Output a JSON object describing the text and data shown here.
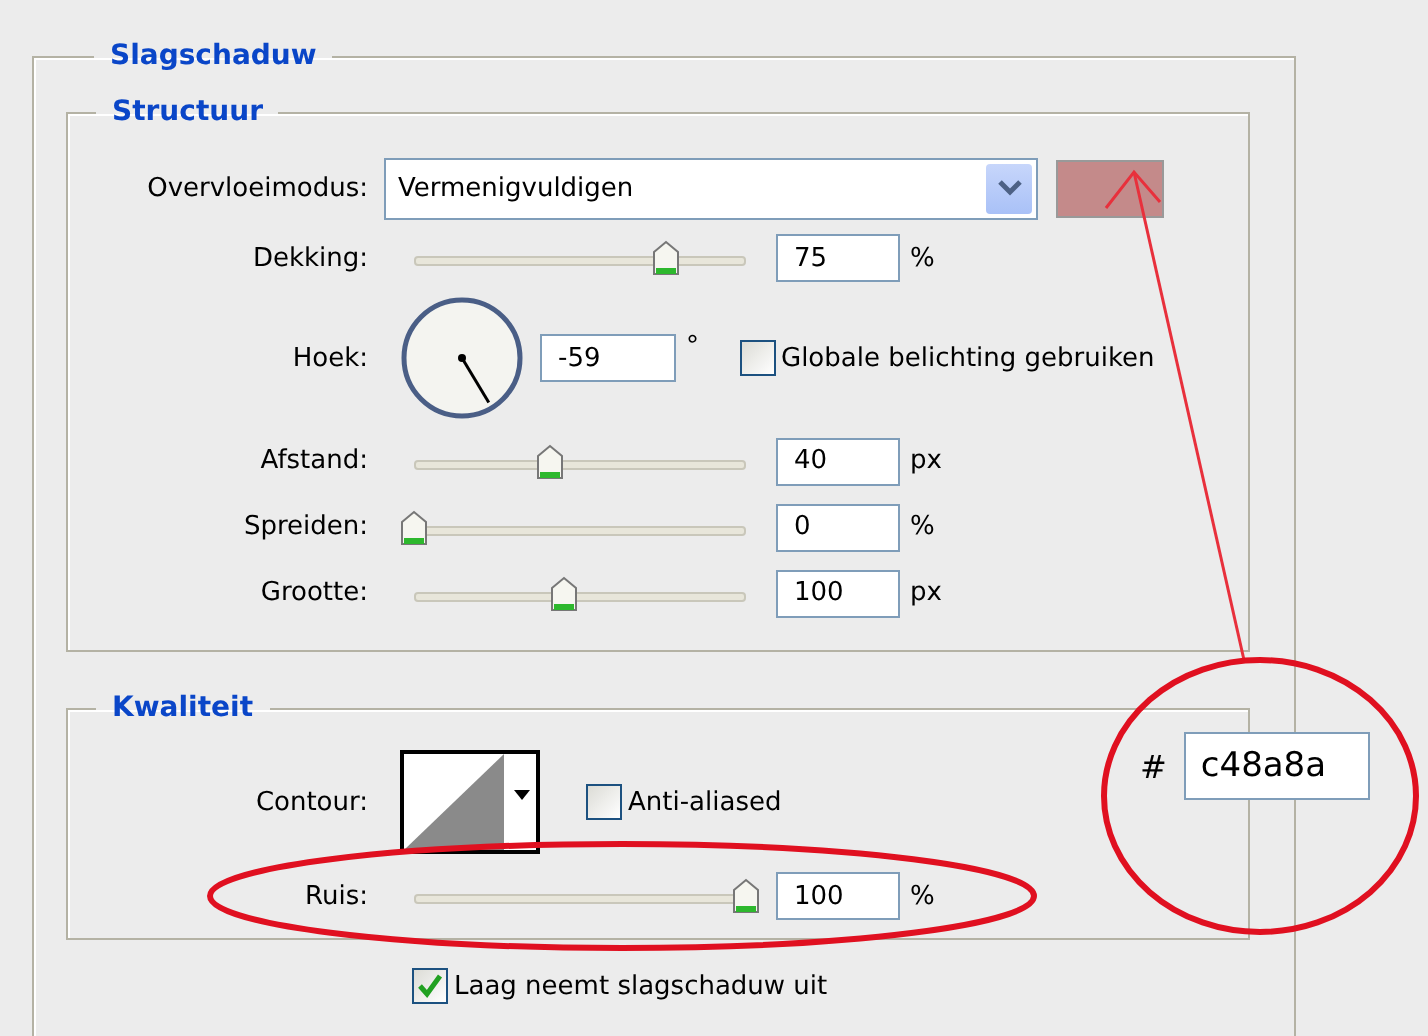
{
  "group": {
    "title": "Slagschaduw"
  },
  "structure": {
    "title": "Structuur",
    "color": "#c48a8a",
    "rows": [
      {
        "kind": "select",
        "label": "Overvloeimodus:",
        "value": "Vermenigvuldigen"
      },
      {
        "kind": "slider",
        "label": "Dekking:",
        "level": 0.76,
        "value": "75",
        "unit": "%"
      },
      {
        "kind": "angle",
        "label": "Hoek:",
        "value": "-59",
        "unit": "°",
        "checkbox": {
          "label": "Globale belichting gebruiken",
          "checked": false
        }
      },
      {
        "kind": "slider",
        "label": "Afstand:",
        "level": 0.41,
        "value": "40",
        "unit": "px"
      },
      {
        "kind": "slider",
        "label": "Spreiden:",
        "level": 0,
        "value": "0",
        "unit": "%"
      },
      {
        "kind": "slider",
        "label": "Grootte:",
        "level": 0.45,
        "value": "100",
        "unit": "px"
      }
    ]
  },
  "quality": {
    "title": "Kwaliteit",
    "contour": {
      "label": "Contour:"
    },
    "anti_aliased": {
      "label": "Anti-aliased",
      "checked": false
    },
    "noise": {
      "label": "Ruis:",
      "level": 1,
      "value": "100",
      "unit": "%"
    }
  },
  "knockout": {
    "label": "Laag neemt slagschaduw uit",
    "checked": true
  },
  "annotation": {
    "hash": "#",
    "hex": "c48a8a"
  }
}
